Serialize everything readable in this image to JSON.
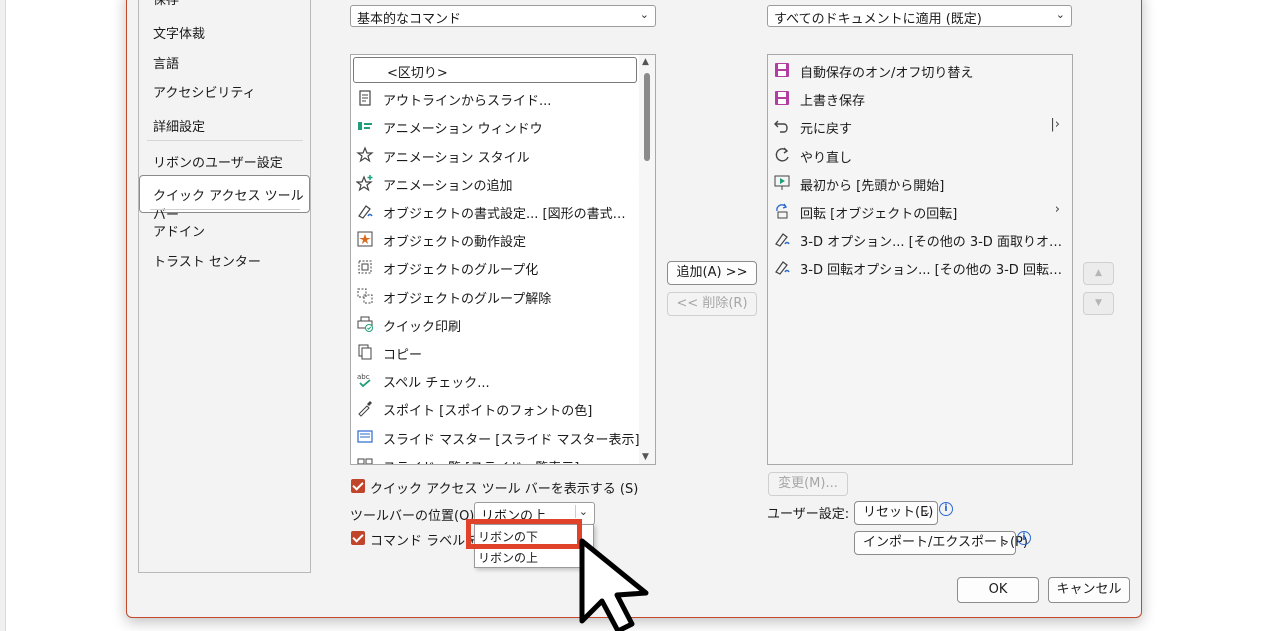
{
  "nav": {
    "items": [
      "保存",
      "文字体裁",
      "言語",
      "アクセシビリティ",
      "詳細設定",
      "リボンのユーザー設定",
      "クイック アクセス ツール バー",
      "アドイン",
      "トラスト センター"
    ]
  },
  "choose_from": {
    "value": "基本的なコマンド"
  },
  "apply_to": {
    "value": "すべてのドキュメントに適用 (既定)"
  },
  "commands": [
    {
      "label": "<区切り>",
      "icon": "separator"
    },
    {
      "label": "アウトラインからスライド...",
      "icon": "document-icon"
    },
    {
      "label": "アニメーション ウィンドウ",
      "icon": "animation-pane-icon"
    },
    {
      "label": "アニメーション スタイル",
      "icon": "star-icon",
      "submenu": "›"
    },
    {
      "label": "アニメーションの追加",
      "icon": "star-add-icon",
      "submenu": "›"
    },
    {
      "label": "オブジェクトの書式設定... [図形の書式…",
      "icon": "format-icon"
    },
    {
      "label": "オブジェクトの動作設定",
      "icon": "action-icon"
    },
    {
      "label": "オブジェクトのグループ化",
      "icon": "group-icon"
    },
    {
      "label": "オブジェクトのグループ解除",
      "icon": "ungroup-icon"
    },
    {
      "label": "クイック印刷",
      "icon": "print-icon"
    },
    {
      "label": "コピー",
      "icon": "copy-icon"
    },
    {
      "label": "スペル チェック...",
      "icon": "spellcheck-icon"
    },
    {
      "label": "スポイト [スポイトのフォントの色]",
      "icon": "eyedropper-icon"
    },
    {
      "label": "スライド マスター [スライド マスター表示]",
      "icon": "slide-master-icon"
    },
    {
      "label": "スライド一覧 [スライド一覧表示]",
      "icon": "slide-sorter-icon"
    }
  ],
  "toolbar_commands": [
    {
      "label": "自動保存のオン/オフ切り替え",
      "icon": "autosave-icon"
    },
    {
      "label": "上書き保存",
      "icon": "save-icon"
    },
    {
      "label": "元に戻す",
      "icon": "undo-icon",
      "submenu": "|›"
    },
    {
      "label": "やり直し",
      "icon": "redo-icon"
    },
    {
      "label": "最初から [先頭から開始]",
      "icon": "slideshow-icon"
    },
    {
      "label": "回転 [オブジェクトの回転]",
      "icon": "rotate-icon",
      "submenu": "›"
    },
    {
      "label": "3-D オプション... [その他の 3-D 面取りオ…",
      "icon": "3d-options-icon"
    },
    {
      "label": "3-D 回転オプション... [その他の 3-D 回転…",
      "icon": "3d-rotation-icon"
    }
  ],
  "buttons": {
    "add": "追加(A) >>",
    "remove": "<< 削除(R)",
    "modify": "変更(M)...",
    "reset": "リセット(E)",
    "import_export": "インポート/エクスポート(P)",
    "ok": "OK",
    "cancel": "キャンセル"
  },
  "options": {
    "show_qat": "クイック アクセス ツール バーを表示する (S)",
    "toolbar_position_label": "ツールバーの位置(O)",
    "toolbar_position_value": "リボンの上",
    "show_labels": "コマンド ラベルを常",
    "user_settings_label": "ユーザー設定:"
  },
  "dropdown": {
    "options": [
      "リボンの下",
      "リボンの上"
    ]
  }
}
